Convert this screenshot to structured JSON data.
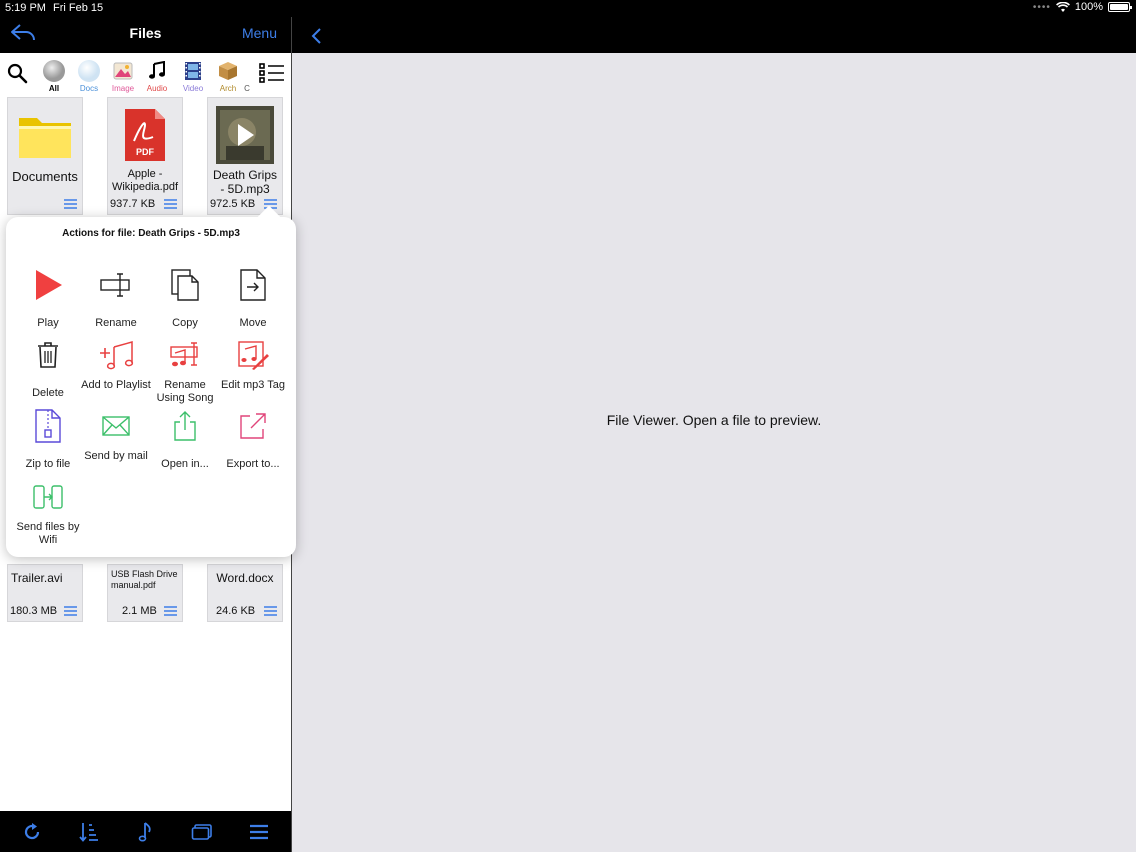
{
  "status_bar": {
    "time": "5:19 PM",
    "date": "Fri Feb 15",
    "battery": "100%"
  },
  "left_nav": {
    "title": "Files",
    "menu_label": "Menu"
  },
  "filters": [
    {
      "label": "All",
      "color": "#000000"
    },
    {
      "label": "Docs",
      "color": "#4a90d9"
    },
    {
      "label": "Image",
      "color": "#e05a9a"
    },
    {
      "label": "Audio",
      "color": "#e04a4a"
    },
    {
      "label": "Video",
      "color": "#8a7ad8"
    },
    {
      "label": "Arch",
      "color": "#b08a2a"
    },
    {
      "label": "C",
      "color": "#555555"
    }
  ],
  "files_top": [
    {
      "name": "Documents",
      "size": ""
    },
    {
      "name": "Apple - Wikipedia.pdf",
      "size": "937.7 KB"
    },
    {
      "name": "Death Grips - 5D.mp3",
      "size": "972.5 KB"
    }
  ],
  "files_bottom": [
    {
      "name": "Trailer.avi",
      "size": "180.3 MB"
    },
    {
      "name": "USB Flash Drive manual.pdf",
      "size": "2.1 MB"
    },
    {
      "name": "Word.docx",
      "size": "24.6 KB"
    }
  ],
  "popover": {
    "title": "Actions for file: Death Grips - 5D.mp3",
    "actions": [
      {
        "label": "Play",
        "icon": "play-icon"
      },
      {
        "label": "Rename",
        "icon": "rename-icon"
      },
      {
        "label": "Copy",
        "icon": "copy-icon"
      },
      {
        "label": "Move",
        "icon": "move-icon"
      },
      {
        "label": "Delete",
        "icon": "trash-icon"
      },
      {
        "label": "Add to Playlist",
        "icon": "add-playlist-icon"
      },
      {
        "label": "Rename Using Song",
        "icon": "rename-song-icon"
      },
      {
        "label": "Edit mp3 Tag",
        "icon": "edit-tag-icon"
      },
      {
        "label": "Zip to file",
        "icon": "zip-icon"
      },
      {
        "label": "Send by mail",
        "icon": "mail-icon"
      },
      {
        "label": "Open in...",
        "icon": "share-icon"
      },
      {
        "label": "Export to...",
        "icon": "export-icon"
      },
      {
        "label": "Send files by Wifi",
        "icon": "wifi-transfer-icon"
      }
    ]
  },
  "viewer": {
    "placeholder": "File Viewer. Open a file to preview."
  },
  "colors": {
    "accent": "#3d7ee8",
    "danger": "#e84040",
    "success": "#3cbf6a",
    "pink": "#e0457a"
  }
}
